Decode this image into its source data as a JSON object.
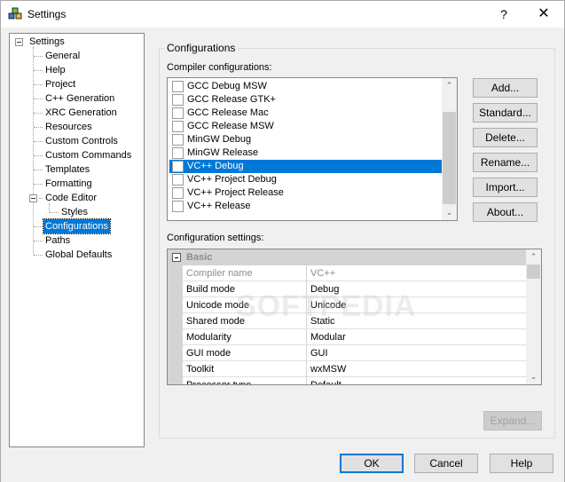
{
  "window": {
    "title": "Settings",
    "help_glyph": "?",
    "close_glyph": "✕"
  },
  "tree": {
    "root": "Settings",
    "items": [
      {
        "label": "General"
      },
      {
        "label": "Help"
      },
      {
        "label": "Project"
      },
      {
        "label": "C++ Generation"
      },
      {
        "label": "XRC Generation"
      },
      {
        "label": "Resources"
      },
      {
        "label": "Custom Controls"
      },
      {
        "label": "Custom Commands"
      },
      {
        "label": "Templates"
      },
      {
        "label": "Formatting"
      },
      {
        "label": "Code Editor"
      },
      {
        "label": "Styles"
      },
      {
        "label": "Configurations",
        "selected": true
      },
      {
        "label": "Paths"
      },
      {
        "label": "Global Defaults"
      }
    ]
  },
  "group": {
    "title": "Configurations"
  },
  "compiler": {
    "label": "Compiler configurations:",
    "items": [
      {
        "label": "GCC Debug MSW"
      },
      {
        "label": "GCC Release GTK+"
      },
      {
        "label": "GCC Release Mac"
      },
      {
        "label": "GCC Release MSW"
      },
      {
        "label": "MinGW Debug"
      },
      {
        "label": "MinGW Release"
      },
      {
        "label": "VC++ Debug",
        "selected": true
      },
      {
        "label": "VC++ Project Debug"
      },
      {
        "label": "VC++ Project Release"
      },
      {
        "label": "VC++ Release"
      }
    ]
  },
  "buttons": {
    "add": "Add...",
    "standard": "Standard...",
    "delete": "Delete...",
    "rename": "Rename...",
    "import": "Import...",
    "about": "About...",
    "expand": "Expand...",
    "ok": "OK",
    "cancel": "Cancel",
    "help": "Help"
  },
  "settings": {
    "label": "Configuration settings:",
    "category": "Basic",
    "rows": [
      {
        "name": "Compiler name",
        "value": "VC++",
        "disabled": true
      },
      {
        "name": "Build mode",
        "value": "Debug"
      },
      {
        "name": "Unicode mode",
        "value": "Unicode"
      },
      {
        "name": "Shared mode",
        "value": "Static"
      },
      {
        "name": "Modularity",
        "value": "Modular"
      },
      {
        "name": "GUI mode",
        "value": "GUI"
      },
      {
        "name": "Toolkit",
        "value": "wxMSW"
      },
      {
        "name": "Processor type",
        "value": "Default"
      }
    ]
  },
  "watermark": "SOFTPEDIA",
  "colors": {
    "accent": "#0078d7"
  }
}
